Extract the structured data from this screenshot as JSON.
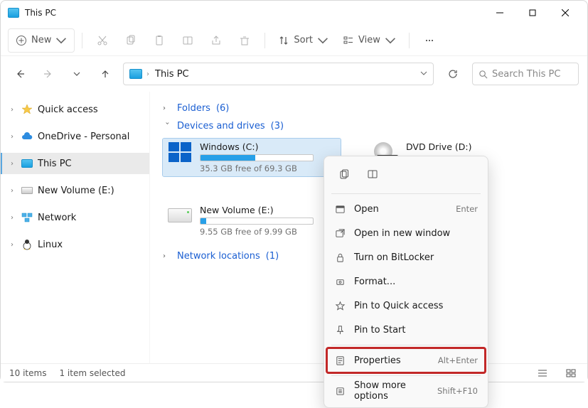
{
  "window": {
    "title": "This PC"
  },
  "toolbar": {
    "new_label": "New",
    "sort_label": "Sort",
    "view_label": "View"
  },
  "address": {
    "crumb": "This PC"
  },
  "search": {
    "placeholder": "Search This PC"
  },
  "nav": {
    "items": [
      {
        "label": "Quick access"
      },
      {
        "label": "OneDrive - Personal"
      },
      {
        "label": "This PC"
      },
      {
        "label": "New Volume (E:)"
      },
      {
        "label": "Network"
      },
      {
        "label": "Linux"
      }
    ]
  },
  "groups": {
    "folders_label": "Folders",
    "folders_count": "(6)",
    "drives_label": "Devices and drives",
    "drives_count": "(3)",
    "netloc_label": "Network locations",
    "netloc_count": "(1)"
  },
  "drives": [
    {
      "name": "Windows (C:)",
      "free": "35.3 GB free of 69.3 GB",
      "fill_pct": 49
    },
    {
      "name": "DVD Drive (D:)"
    },
    {
      "name": "New Volume (E:)",
      "free": "9.55 GB free of 9.99 GB",
      "fill_pct": 5
    }
  ],
  "context_menu": {
    "items": [
      {
        "label": "Open",
        "shortcut": "Enter"
      },
      {
        "label": "Open in new window"
      },
      {
        "label": "Turn on BitLocker"
      },
      {
        "label": "Format..."
      },
      {
        "label": "Pin to Quick access"
      },
      {
        "label": "Pin to Start"
      },
      {
        "label": "Properties",
        "shortcut": "Alt+Enter"
      },
      {
        "label": "Show more options",
        "shortcut": "Shift+F10"
      }
    ]
  },
  "status": {
    "items": "10 items",
    "selection": "1 item selected"
  }
}
